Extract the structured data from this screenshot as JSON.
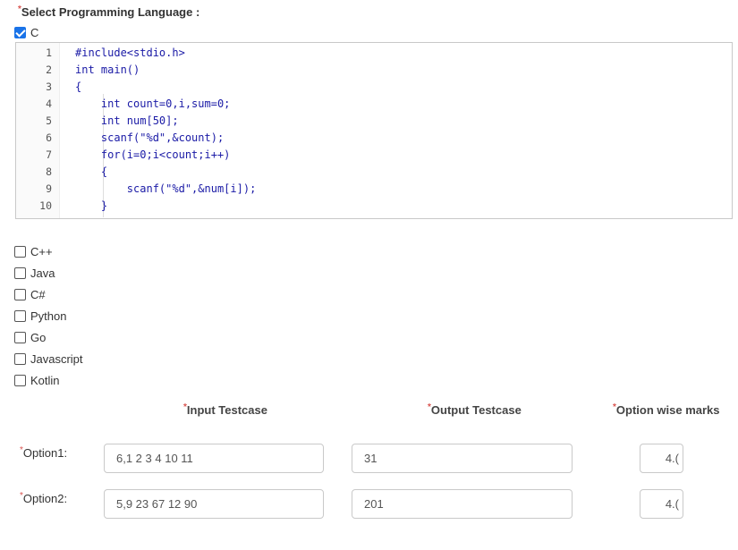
{
  "form": {
    "title": "Select Programming Language :",
    "required_mark": "*"
  },
  "languages": [
    {
      "label": "C",
      "checked": true
    },
    {
      "label": "C++",
      "checked": false
    },
    {
      "label": "Java",
      "checked": false
    },
    {
      "label": "C#",
      "checked": false
    },
    {
      "label": "Python",
      "checked": false
    },
    {
      "label": "Go",
      "checked": false
    },
    {
      "label": "Javascript",
      "checked": false
    },
    {
      "label": "Kotlin",
      "checked": false
    }
  ],
  "editor": {
    "lines": [
      {
        "num": "1",
        "code": "#include<stdio.h>"
      },
      {
        "num": "2",
        "code": "int main()"
      },
      {
        "num": "3",
        "code": "{"
      },
      {
        "num": "4",
        "code": "    int count=0,i,sum=0;"
      },
      {
        "num": "5",
        "code": "    int num[50];"
      },
      {
        "num": "6",
        "code": "    scanf(\"%d\",&count);"
      },
      {
        "num": "7",
        "code": "    for(i=0;i<count;i++)"
      },
      {
        "num": "8",
        "code": "    {"
      },
      {
        "num": "9",
        "code": "        scanf(\"%d\",&num[i]);"
      },
      {
        "num": "10",
        "code": "    }"
      }
    ]
  },
  "testcases": {
    "headers": {
      "input": "Input Testcase",
      "output": "Output Testcase",
      "marks": "Option wise marks"
    },
    "options": [
      {
        "label": "Option1:",
        "input": "6,1 2 3 4 10 11",
        "output": "31",
        "marks": "4.("
      },
      {
        "label": "Option2:",
        "input": "5,9 23 67 12 90",
        "output": "201",
        "marks": "4.("
      }
    ]
  },
  "colors": {
    "accent": "#1a73e8",
    "required": "#d9534f",
    "code_text": "#1a1aa6"
  }
}
